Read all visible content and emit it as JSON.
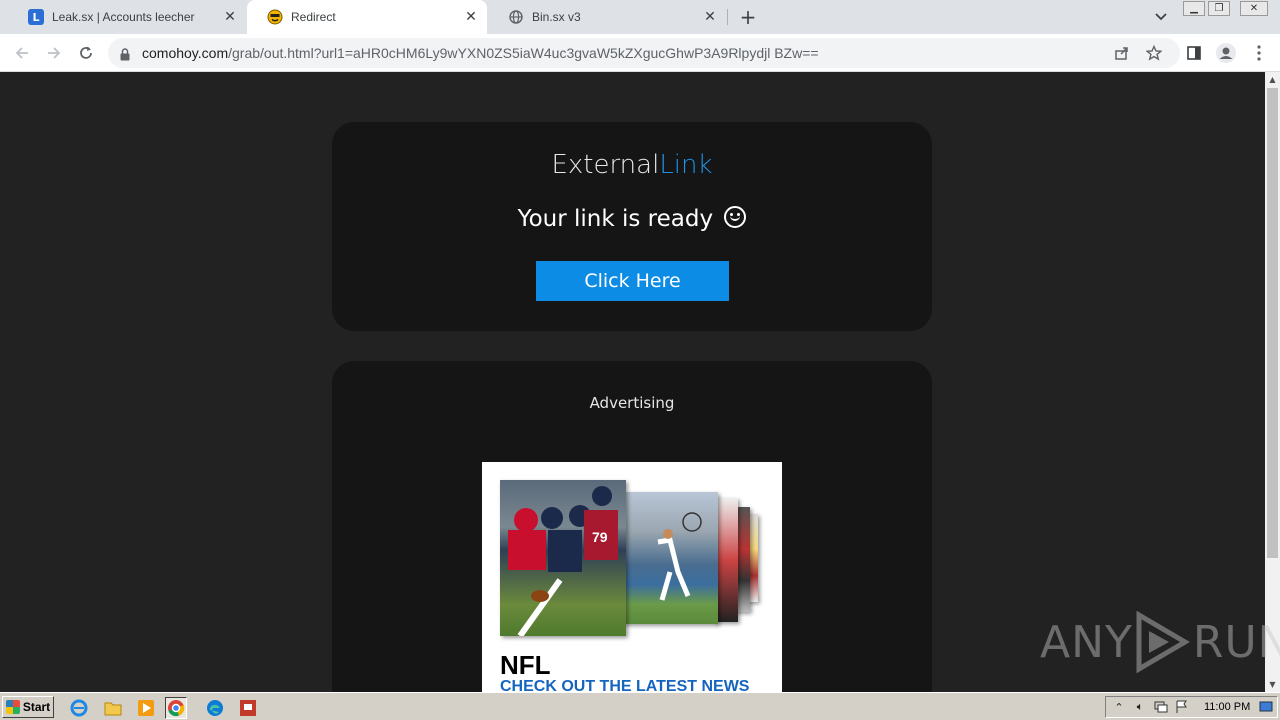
{
  "tabs": [
    {
      "title": "Leak.sx | Accounts leecher",
      "favicon_letter": "L",
      "favicon_color": "#2b6fd6",
      "active": false
    },
    {
      "title": "Redirect",
      "favicon_color": "#f4b400",
      "active": true
    },
    {
      "title": "Bin.sx v3",
      "favicon": "globe-icon",
      "active": false
    }
  ],
  "toolbar": {
    "url_host": "comohoy.com",
    "url_path": "/grab/out.html?url1=aHR0cHM6Ly9wYXN0ZS5iaW4uc3gvaW5kZXgucGhwP3A9Rlpydjl BZw=="
  },
  "card": {
    "brand_part1": "External",
    "brand_part2": "Link",
    "ready_text": "Your link is ready",
    "button_label": "Click Here"
  },
  "ad": {
    "label": "Advertising",
    "title": "NFL",
    "subtitle": "CHECK OUT THE LATEST NEWS"
  },
  "watermark": {
    "left": "ANY",
    "right": "RUN"
  },
  "taskbar": {
    "start_label": "Start",
    "clock": "11:00 PM"
  },
  "colors": {
    "accent": "#0d8ce6",
    "brand_link": "#1e90e6",
    "page_bg": "#222222"
  }
}
